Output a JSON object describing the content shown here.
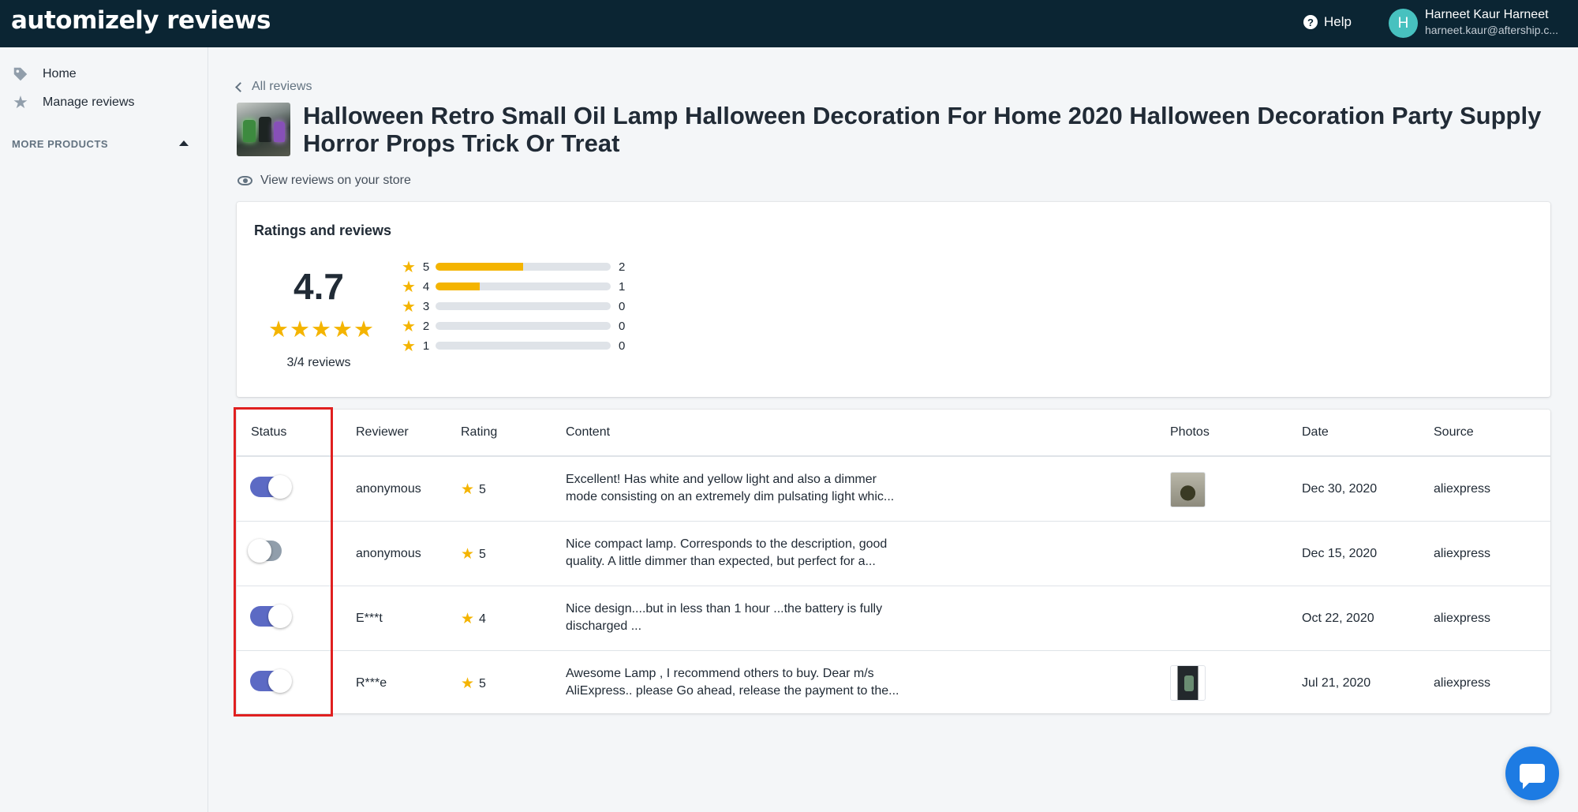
{
  "brand": {
    "logo_text": "automizely reviews"
  },
  "header": {
    "help_label": "Help",
    "user_initial": "H",
    "user_name": "Harneet Kaur Harneet",
    "user_email": "harneet.kaur@aftership.c..."
  },
  "sidebar": {
    "items": [
      {
        "label": "Home",
        "icon": "tag-icon"
      },
      {
        "label": "Manage reviews",
        "icon": "star-icon"
      }
    ],
    "more_products_label": "MORE PRODUCTS"
  },
  "page": {
    "back_label": "All reviews",
    "title": "Halloween Retro Small Oil Lamp Halloween Decoration For Home 2020 Halloween Decoration Party Supply Horror Props Trick Or Treat",
    "view_store_label": "View reviews on your store"
  },
  "ratings": {
    "title": "Ratings and reviews",
    "average": "4.7",
    "average_value": 4.7,
    "count_label": "3/4 reviews",
    "distribution": [
      {
        "stars": "5",
        "count": "2",
        "fraction": 0.5
      },
      {
        "stars": "4",
        "count": "1",
        "fraction": 0.25
      },
      {
        "stars": "3",
        "count": "0",
        "fraction": 0
      },
      {
        "stars": "2",
        "count": "0",
        "fraction": 0
      },
      {
        "stars": "1",
        "count": "0",
        "fraction": 0
      }
    ]
  },
  "table": {
    "columns": {
      "status": "Status",
      "reviewer": "Reviewer",
      "rating": "Rating",
      "content": "Content",
      "photos": "Photos",
      "date": "Date",
      "source": "Source"
    },
    "rows": [
      {
        "enabled": true,
        "reviewer": "anonymous",
        "rating": "5",
        "content_line1": "Excellent! Has white and yellow light and also a dimmer",
        "content_line2": "mode consisting on an extremely dim pulsating light whic...",
        "has_photo": true,
        "date": "Dec 30, 2020",
        "source": "aliexpress"
      },
      {
        "enabled": false,
        "reviewer": "anonymous",
        "rating": "5",
        "content_line1": "Nice compact lamp. Corresponds to the description, good",
        "content_line2": "quality. A little dimmer than expected, but perfect for a...",
        "has_photo": false,
        "date": "Dec 15, 2020",
        "source": "aliexpress"
      },
      {
        "enabled": true,
        "reviewer": "E***t",
        "rating": "4",
        "content_line1": "Nice design....but in less than 1 hour ...the battery is fully",
        "content_line2": "discharged ...",
        "has_photo": false,
        "date": "Oct 22, 2020",
        "source": "aliexpress"
      },
      {
        "enabled": true,
        "reviewer": "R***e",
        "rating": "5",
        "content_line1": "Awesome Lamp , I recommend others to buy. Dear m/s",
        "content_line2": "AliExpress.. please Go ahead, release the payment to the...",
        "has_photo": true,
        "date": "Jul 21, 2020",
        "source": "aliexpress"
      }
    ]
  },
  "colors": {
    "topbar": "#0b2533",
    "accent_toggle": "#5c6ac4",
    "star": "#f4b400",
    "highlight": "#e02020",
    "chat": "#1d7be3"
  }
}
